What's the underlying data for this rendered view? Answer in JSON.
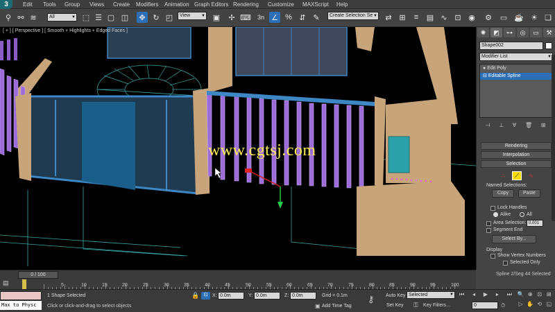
{
  "menubar": {
    "logo": "3",
    "items": [
      "Edit",
      "Tools",
      "Group",
      "Views",
      "Create",
      "Modifiers",
      "Animation",
      "Graph Editors",
      "Rendering",
      "Customize",
      "MAXScript",
      "Help"
    ]
  },
  "toolbar": {
    "filter_select": "All",
    "view_select": "View",
    "snap_label": "3n",
    "selection_set_placeholder": "Create Selection Se"
  },
  "viewport": {
    "label": "[ + ] [ Perspective ] [ Smooth + Highlights + Edged Faces ]",
    "watermark": "www.cgtsj.com"
  },
  "command_panel": {
    "object_name": "Shape002",
    "modifier_list": "Modifier List",
    "stack": [
      {
        "label": "Edit Poly",
        "selected": false
      },
      {
        "label": "Editable Spline",
        "selected": true
      }
    ],
    "rollouts": {
      "rendering": "Rendering",
      "interpolation": "Interpolation",
      "selection": "Selection"
    },
    "named_selections": {
      "title": "Named Selections:",
      "copy": "Copy",
      "paste": "Paste"
    },
    "lock_handles": "Lock Handles",
    "alike": "Alike",
    "all": "All",
    "area_selection": "Area Selection:",
    "area_value": "0.001",
    "segment_end": "Segment End",
    "select_by": "Select By...",
    "display_title": "Display",
    "show_vertex_numbers": "Show Vertex Numbers",
    "selected_only": "Selected Only",
    "status": "Spline 2/Seg 44 Selected"
  },
  "timeline": {
    "frame_label": "0 / 100",
    "ticks": [
      "0",
      "5",
      "10",
      "15",
      "20",
      "25",
      "30",
      "35",
      "40",
      "45",
      "50",
      "55",
      "60",
      "65",
      "70",
      "75",
      "80",
      "85",
      "90",
      "95",
      "100"
    ]
  },
  "statusbar": {
    "script_listener": "Max to Physc",
    "selected_text": "1 Shape Selected",
    "prompt": "Click or click-and-drag to select objects",
    "x_label": "X:",
    "x_value": "0.0m",
    "y_label": "Y:",
    "y_value": "0.0m",
    "z_label": "Z:",
    "z_value": "0.0m",
    "grid": "Grid = 0.1m",
    "add_time_tag": "Add Time Tag",
    "auto_key": "Auto Key",
    "auto_key_mode": "Selected",
    "set_key": "Set Key",
    "key_filters": "Key Filters...",
    "frame_value": "0"
  },
  "colors": {
    "accent_blue": "#2c6fb7",
    "watermark_yellow": "#ffee55",
    "wall_tan": "#c8a47a",
    "glass_blue": "#1a5e8a",
    "slat_purple": "#9b6bd8",
    "autokey_red": "#c54a3a"
  }
}
